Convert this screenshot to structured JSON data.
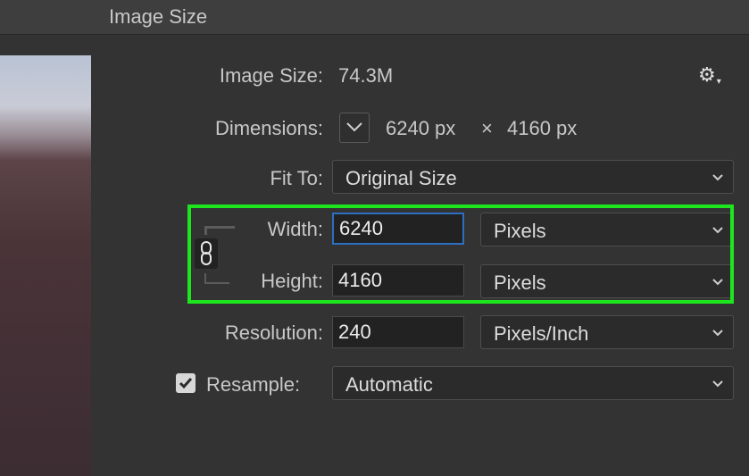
{
  "window": {
    "title": "Image Size"
  },
  "image_size": {
    "label": "Image Size:",
    "value": "74.3M"
  },
  "dimensions": {
    "label": "Dimensions:",
    "width": "6240 px",
    "times": "×",
    "height": "4160 px"
  },
  "fit_to": {
    "label": "Fit To:",
    "selected": "Original Size"
  },
  "width": {
    "label": "Width:",
    "value": "6240",
    "unit": "Pixels"
  },
  "height": {
    "label": "Height:",
    "value": "4160",
    "unit": "Pixels"
  },
  "resolution": {
    "label": "Resolution:",
    "value": "240",
    "unit": "Pixels/Inch"
  },
  "resample": {
    "label": "Resample:",
    "checked": true,
    "selected": "Automatic"
  },
  "colors": {
    "highlight": "#1ee61e",
    "focus": "#2d6fc2",
    "background": "#333333"
  },
  "icons": [
    "gear-icon",
    "chevron-down-icon",
    "link-icon",
    "checkmark-icon"
  ]
}
